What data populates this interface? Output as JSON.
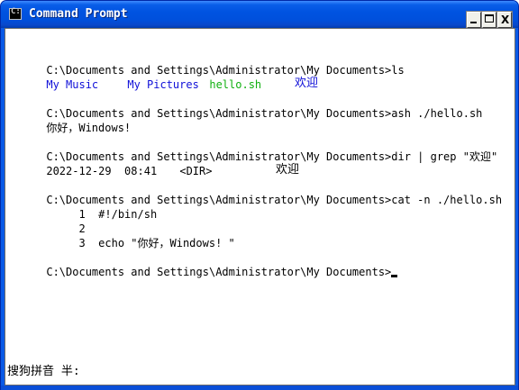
{
  "window": {
    "title": "Command Prompt",
    "icon": "console-icon",
    "controls": {
      "minimize": "minimize-icon",
      "maximize": "maximize-icon",
      "close_glyph": "X"
    }
  },
  "console": {
    "lines": [
      {
        "id": "prompt-1",
        "segments": [
          {
            "text": "C:\\Documents and Settings\\Administrator\\My Documents>ls"
          }
        ]
      },
      {
        "id": "ls-output",
        "segments": [
          {
            "text": "My Music",
            "color": "blue"
          },
          {
            "text": "My Pictures",
            "color": "blue"
          },
          {
            "text": "hello.sh",
            "color": "green"
          },
          {
            "text": "欢迎",
            "color": "blue"
          }
        ]
      },
      {
        "id": "prompt-2",
        "segments": [
          {
            "text": "C:\\Documents and Settings\\Administrator\\My Documents>ash ./hello.sh"
          }
        ]
      },
      {
        "id": "ash-output",
        "segments": [
          {
            "text": "你好，Windows!"
          }
        ]
      },
      {
        "id": "prompt-3",
        "segments": [
          {
            "text": "C:\\Documents and Settings\\Administrator\\My Documents>dir | grep \"欢迎\""
          }
        ]
      },
      {
        "id": "dir-output",
        "segments": [
          {
            "text": "2022-12-29  08:41"
          },
          {
            "text": "<DIR>"
          },
          {
            "text": "欢迎"
          }
        ]
      },
      {
        "id": "prompt-4",
        "segments": [
          {
            "text": "C:\\Documents and Settings\\Administrator\\My Documents>cat -n ./hello.sh"
          }
        ]
      },
      {
        "id": "cat-line-1",
        "segments": [
          {
            "text": "     1  #!/bin/sh"
          }
        ]
      },
      {
        "id": "cat-line-2",
        "segments": [
          {
            "text": "     2"
          }
        ]
      },
      {
        "id": "cat-line-3",
        "segments": [
          {
            "text": "     3  echo \"你好，Windows! \""
          }
        ]
      },
      {
        "id": "prompt-5",
        "segments": [
          {
            "text": "C:\\Documents and Settings\\Administrator\\My Documents>"
          }
        ]
      }
    ],
    "colors": {
      "blue": "#1010d8",
      "green": "#10b010",
      "text": "#000000",
      "background": "#ffffff"
    }
  },
  "ime_status": "搜狗拼音 半:"
}
